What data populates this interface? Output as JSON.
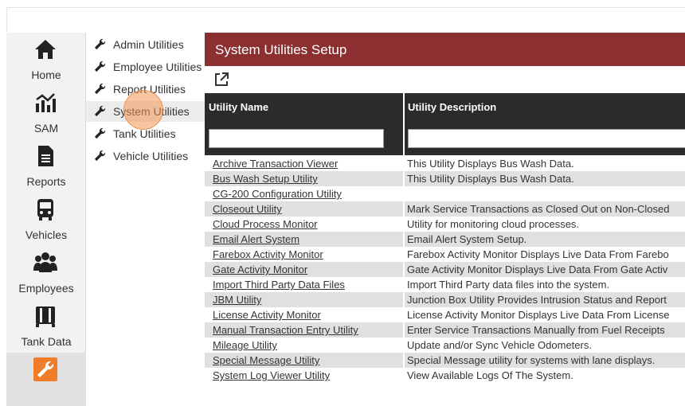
{
  "nav": {
    "items": [
      {
        "label": "Home",
        "icon": "home-icon"
      },
      {
        "label": "SAM",
        "icon": "chart-icon"
      },
      {
        "label": "Reports",
        "icon": "document-icon"
      },
      {
        "label": "Vehicles",
        "icon": "bus-icon"
      },
      {
        "label": "Employees",
        "icon": "users-icon"
      },
      {
        "label": "Tank Data",
        "icon": "tank-icon"
      },
      {
        "label": "",
        "icon": "wrench-icon"
      }
    ],
    "accent": "#f07d2a"
  },
  "submenu": {
    "items": [
      {
        "label": "Admin Utilities"
      },
      {
        "label": "Employee Utilities"
      },
      {
        "label": "Report Utilities"
      },
      {
        "label": "System Utilities"
      },
      {
        "label": "Tank Utilities"
      },
      {
        "label": "Vehicle Utilities"
      }
    ]
  },
  "panel": {
    "title": "System Utilities Setup",
    "header_color": "#8b2f30",
    "columns": {
      "name": "Utility Name",
      "description": "Utility Description"
    },
    "filters": {
      "name": "",
      "description": ""
    },
    "rows": [
      {
        "name": "Archive Transaction Viewer",
        "description": "This Utility Displays Bus Wash Data."
      },
      {
        "name": "Bus Wash Setup Utility",
        "description": "This Utility Displays Bus Wash Data."
      },
      {
        "name": "CG-200 Configuration Utility",
        "description": ""
      },
      {
        "name": "Closeout Utility",
        "description": "Mark Service Transactions as Closed Out on Non-Closed"
      },
      {
        "name": "Cloud Process Monitor",
        "description": "Utility for monitoring cloud processes."
      },
      {
        "name": "Email Alert System",
        "description": "Email Alert System Setup."
      },
      {
        "name": "Farebox Activity Monitor",
        "description": "Farebox Activity Monitor Displays Live Data From Farebo"
      },
      {
        "name": "Gate Activity Monitor",
        "description": "Gate Activity Monitor Displays Live Data From Gate Activ"
      },
      {
        "name": "Import Third Party Data Files",
        "description": "Import Third Party data files into the system."
      },
      {
        "name": "JBM Utility",
        "description": "Junction Box Utility Provides Intrusion Status and Report"
      },
      {
        "name": "License Activity Monitor",
        "description": "License Activity Monitor Displays Live Data From License"
      },
      {
        "name": "Manual Transaction Entry Utility",
        "description": "Enter Service Transactions Manually from Fuel Receipts"
      },
      {
        "name": "Mileage Utility",
        "description": "Update and/or Sync Vehicle Odometers."
      },
      {
        "name": "Special Message Utility",
        "description": "Special Message utility for systems with lane displays."
      },
      {
        "name": "System Log Viewer Utility",
        "description": "View Available Logs Of The System."
      }
    ]
  }
}
